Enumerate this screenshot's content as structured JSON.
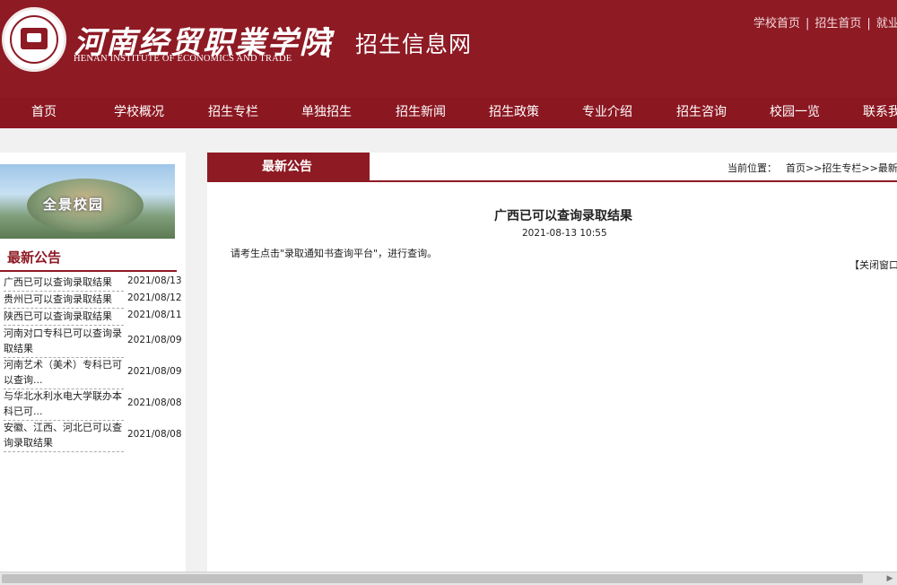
{
  "header": {
    "logo_cn": "河南经贸职業学院",
    "logo_en": "HENAN INSTITUTE OF ECONOMICS AND TRADE",
    "subtitle": "招生信息网",
    "top_links": [
      "学校首页",
      "招生首页",
      "就业"
    ]
  },
  "nav": {
    "items": [
      "首页",
      "学校概况",
      "招生专栏",
      "单独招生",
      "招生新闻",
      "招生政策",
      "专业介绍",
      "招生咨询",
      "校园一览",
      "联系我"
    ]
  },
  "left": {
    "campus_caption": "全景校园",
    "title": "最新公告",
    "news": [
      {
        "title": "广西已可以查询录取结果",
        "date": "2021/08/13"
      },
      {
        "title": "贵州已可以查询录取结果",
        "date": "2021/08/12"
      },
      {
        "title": "陕西已可以查询录取结果",
        "date": "2021/08/11"
      },
      {
        "title": "河南对口专科已可以查询录取结果",
        "date": "2021/08/09"
      },
      {
        "title": "河南艺术（美术）专科已可以查询...",
        "date": "2021/08/09"
      },
      {
        "title": "与华北水利水电大学联办本科已可...",
        "date": "2021/08/08"
      },
      {
        "title": "安徽、江西、河北已可以查询录取结果",
        "date": "2021/08/08"
      }
    ]
  },
  "main": {
    "tab": "最新公告",
    "breadcrumb": {
      "label": "当前位置：",
      "path": "首页>>招生专栏>>最新公告>"
    },
    "article": {
      "title": "广西已可以查询录取结果",
      "time": "2021-08-13  10:55",
      "body": "请考生点击\"录取通知书查询平台\"，进行查询。"
    },
    "close_label": "【关闭窗口"
  },
  "colors": {
    "brand": "#8e1a24",
    "nav": "#8b1721"
  }
}
